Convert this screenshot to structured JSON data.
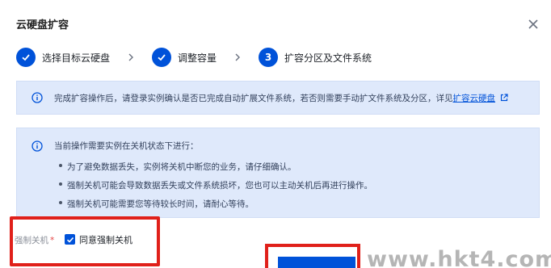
{
  "dialog": {
    "title": "云硬盘扩容"
  },
  "steps": [
    {
      "mark": "",
      "label": "选择目标云硬盘",
      "state": "done"
    },
    {
      "mark": "",
      "label": "调整容量",
      "state": "done"
    },
    {
      "mark": "3",
      "label": "扩容分区及文件系统",
      "state": "active"
    }
  ],
  "notice": {
    "text": "完成扩容操作后，请登录实例确认是否已完成自动扩展文件系统，若否则需要手动扩文件系统及分区，详见",
    "link": "扩容云硬盘"
  },
  "warning": {
    "heading": "当前操作需要实例在关机状态下进行：",
    "items": [
      "为了避免数据丢失，实例将关机中断您的业务，请仔细确认。",
      "强制关机可能会导致数据丢失或文件系统损坏，您也可以主动关机后再进行操作。",
      "强制关机可能需要您等待较长时间，请耐心等待。"
    ]
  },
  "force_shutdown": {
    "label": "强制关机",
    "required_mark": "*",
    "checkbox_label": "同意强制关机",
    "checked": true
  },
  "watermark": "www.hkt4.com",
  "colors": {
    "accent": "#0052d9",
    "info_bg": "#dfe9fb",
    "highlight": "#e0201a"
  },
  "icons": [
    "close-icon",
    "check-icon",
    "chevron-right-icon",
    "info-icon",
    "external-link-icon"
  ]
}
